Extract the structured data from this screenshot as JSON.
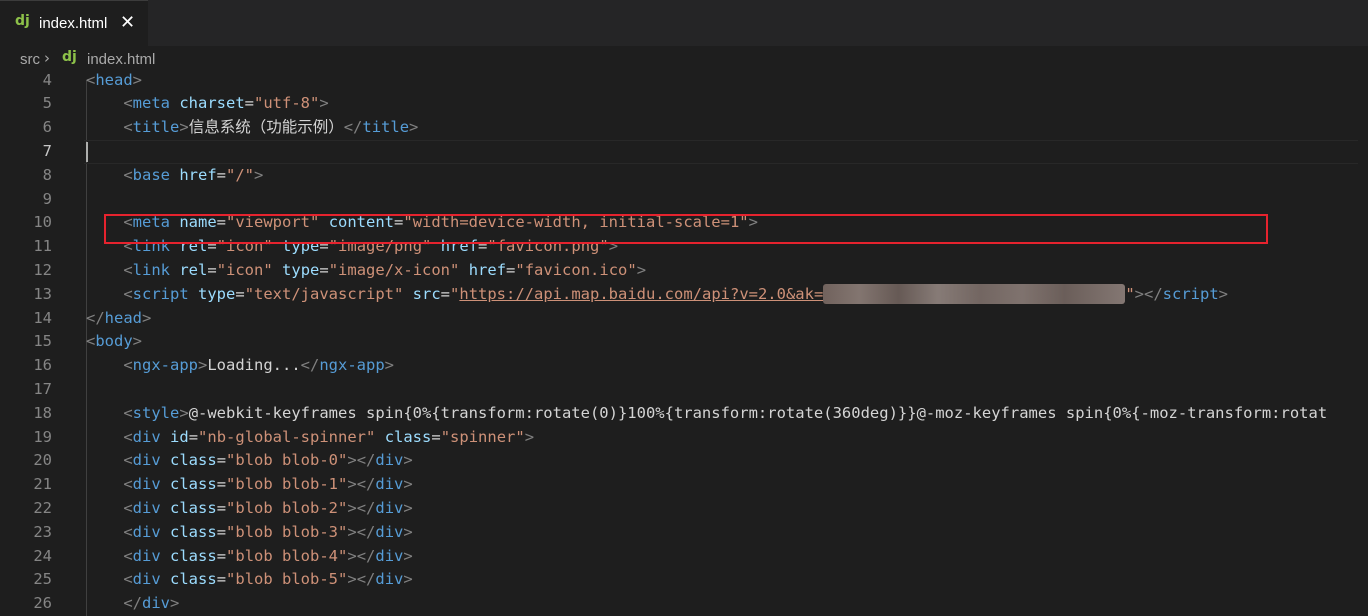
{
  "tab": {
    "icon": "dj",
    "label": "index.html",
    "close": "✕"
  },
  "breadcrumb": {
    "folder": "src",
    "separator": "›",
    "file_icon": "dj",
    "file": "index.html"
  },
  "editor": {
    "active_line": "7",
    "lines": [
      {
        "n": "4",
        "tokens": [
          [
            "punc",
            "<"
          ],
          [
            "tag",
            "head"
          ],
          [
            "punc",
            ">"
          ]
        ]
      },
      {
        "n": "5",
        "tokens": [
          [
            "txt",
            "    "
          ],
          [
            "punc",
            "<"
          ],
          [
            "tag",
            "meta"
          ],
          [
            "txt",
            " "
          ],
          [
            "attr",
            "charset"
          ],
          [
            "txt",
            "="
          ],
          [
            "str",
            "\"utf-8\""
          ],
          [
            "punc",
            ">"
          ]
        ]
      },
      {
        "n": "6",
        "tokens": [
          [
            "txt",
            "    "
          ],
          [
            "punc",
            "<"
          ],
          [
            "tag",
            "title"
          ],
          [
            "punc",
            ">"
          ],
          [
            "txt",
            "信息系统（功能示例）"
          ],
          [
            "punc",
            "</"
          ],
          [
            "tag",
            "title"
          ],
          [
            "punc",
            ">"
          ]
        ]
      },
      {
        "n": "7",
        "tokens": []
      },
      {
        "n": "8",
        "tokens": [
          [
            "txt",
            "    "
          ],
          [
            "punc",
            "<"
          ],
          [
            "tag",
            "base"
          ],
          [
            "txt",
            " "
          ],
          [
            "attr",
            "href"
          ],
          [
            "txt",
            "="
          ],
          [
            "str",
            "\"/\""
          ],
          [
            "punc",
            ">"
          ]
        ]
      },
      {
        "n": "9",
        "tokens": []
      },
      {
        "n": "10",
        "tokens": [
          [
            "txt",
            "    "
          ],
          [
            "punc",
            "<"
          ],
          [
            "tag",
            "meta"
          ],
          [
            "txt",
            " "
          ],
          [
            "attr",
            "name"
          ],
          [
            "txt",
            "="
          ],
          [
            "str",
            "\"viewport\""
          ],
          [
            "txt",
            " "
          ],
          [
            "attr",
            "content"
          ],
          [
            "txt",
            "="
          ],
          [
            "str",
            "\"width=device-width, initial-scale=1\""
          ],
          [
            "punc",
            ">"
          ]
        ]
      },
      {
        "n": "11",
        "tokens": [
          [
            "txt",
            "    "
          ],
          [
            "punc",
            "<"
          ],
          [
            "tag",
            "link"
          ],
          [
            "txt",
            " "
          ],
          [
            "attr",
            "rel"
          ],
          [
            "txt",
            "="
          ],
          [
            "str",
            "\"icon\""
          ],
          [
            "txt",
            " "
          ],
          [
            "attr",
            "type"
          ],
          [
            "txt",
            "="
          ],
          [
            "str",
            "\"image/png\""
          ],
          [
            "txt",
            " "
          ],
          [
            "attr",
            "href"
          ],
          [
            "txt",
            "="
          ],
          [
            "str",
            "\"favicon.png\""
          ],
          [
            "punc",
            ">"
          ]
        ]
      },
      {
        "n": "12",
        "tokens": [
          [
            "txt",
            "    "
          ],
          [
            "punc",
            "<"
          ],
          [
            "tag",
            "link"
          ],
          [
            "txt",
            " "
          ],
          [
            "attr",
            "rel"
          ],
          [
            "txt",
            "="
          ],
          [
            "str",
            "\"icon\""
          ],
          [
            "txt",
            " "
          ],
          [
            "attr",
            "type"
          ],
          [
            "txt",
            "="
          ],
          [
            "str",
            "\"image/x-icon\""
          ],
          [
            "txt",
            " "
          ],
          [
            "attr",
            "href"
          ],
          [
            "txt",
            "="
          ],
          [
            "str",
            "\"favicon.ico\""
          ],
          [
            "punc",
            ">"
          ]
        ]
      },
      {
        "n": "13",
        "tokens": [
          [
            "txt",
            "    "
          ],
          [
            "punc",
            "<"
          ],
          [
            "tag",
            "script"
          ],
          [
            "txt",
            " "
          ],
          [
            "attr",
            "type"
          ],
          [
            "txt",
            "="
          ],
          [
            "str",
            "\"text/javascript\""
          ],
          [
            "txt",
            " "
          ],
          [
            "attr",
            "src"
          ],
          [
            "txt",
            "="
          ],
          [
            "str",
            "\""
          ],
          [
            "link",
            "https://api.map.baidu.com/api?v=2.0&ak="
          ],
          [
            "blur",
            ""
          ],
          [
            "str",
            "\""
          ],
          [
            "punc",
            "></"
          ],
          [
            "tag",
            "script"
          ],
          [
            "punc",
            ">"
          ]
        ]
      },
      {
        "n": "14",
        "tokens": [
          [
            "punc",
            "</"
          ],
          [
            "tag",
            "head"
          ],
          [
            "punc",
            ">"
          ]
        ]
      },
      {
        "n": "15",
        "tokens": [
          [
            "punc",
            "<"
          ],
          [
            "tag",
            "body"
          ],
          [
            "punc",
            ">"
          ]
        ]
      },
      {
        "n": "16",
        "tokens": [
          [
            "txt",
            "    "
          ],
          [
            "punc",
            "<"
          ],
          [
            "tag",
            "ngx-app"
          ],
          [
            "punc",
            ">"
          ],
          [
            "txt",
            "Loading..."
          ],
          [
            "punc",
            "</"
          ],
          [
            "tag",
            "ngx-app"
          ],
          [
            "punc",
            ">"
          ]
        ]
      },
      {
        "n": "17",
        "tokens": []
      },
      {
        "n": "18",
        "tokens": [
          [
            "txt",
            "    "
          ],
          [
            "punc",
            "<"
          ],
          [
            "tag",
            "style"
          ],
          [
            "punc",
            ">"
          ],
          [
            "txt",
            "@-webkit-keyframes spin{0%{transform:rotate(0)}100%{transform:rotate(360deg)}}@-moz-keyframes spin{0%{-moz-transform:rotat"
          ]
        ]
      },
      {
        "n": "19",
        "tokens": [
          [
            "txt",
            "    "
          ],
          [
            "punc",
            "<"
          ],
          [
            "tag",
            "div"
          ],
          [
            "txt",
            " "
          ],
          [
            "attr",
            "id"
          ],
          [
            "txt",
            "="
          ],
          [
            "str",
            "\"nb-global-spinner\""
          ],
          [
            "txt",
            " "
          ],
          [
            "attr",
            "class"
          ],
          [
            "txt",
            "="
          ],
          [
            "str",
            "\"spinner\""
          ],
          [
            "punc",
            ">"
          ]
        ]
      },
      {
        "n": "20",
        "tokens": [
          [
            "txt",
            "    "
          ],
          [
            "punc",
            "<"
          ],
          [
            "tag",
            "div"
          ],
          [
            "txt",
            " "
          ],
          [
            "attr",
            "class"
          ],
          [
            "txt",
            "="
          ],
          [
            "str",
            "\"blob blob-0\""
          ],
          [
            "punc",
            "></"
          ],
          [
            "tag",
            "div"
          ],
          [
            "punc",
            ">"
          ]
        ]
      },
      {
        "n": "21",
        "tokens": [
          [
            "txt",
            "    "
          ],
          [
            "punc",
            "<"
          ],
          [
            "tag",
            "div"
          ],
          [
            "txt",
            " "
          ],
          [
            "attr",
            "class"
          ],
          [
            "txt",
            "="
          ],
          [
            "str",
            "\"blob blob-1\""
          ],
          [
            "punc",
            "></"
          ],
          [
            "tag",
            "div"
          ],
          [
            "punc",
            ">"
          ]
        ]
      },
      {
        "n": "22",
        "tokens": [
          [
            "txt",
            "    "
          ],
          [
            "punc",
            "<"
          ],
          [
            "tag",
            "div"
          ],
          [
            "txt",
            " "
          ],
          [
            "attr",
            "class"
          ],
          [
            "txt",
            "="
          ],
          [
            "str",
            "\"blob blob-2\""
          ],
          [
            "punc",
            "></"
          ],
          [
            "tag",
            "div"
          ],
          [
            "punc",
            ">"
          ]
        ]
      },
      {
        "n": "23",
        "tokens": [
          [
            "txt",
            "    "
          ],
          [
            "punc",
            "<"
          ],
          [
            "tag",
            "div"
          ],
          [
            "txt",
            " "
          ],
          [
            "attr",
            "class"
          ],
          [
            "txt",
            "="
          ],
          [
            "str",
            "\"blob blob-3\""
          ],
          [
            "punc",
            "></"
          ],
          [
            "tag",
            "div"
          ],
          [
            "punc",
            ">"
          ]
        ]
      },
      {
        "n": "24",
        "tokens": [
          [
            "txt",
            "    "
          ],
          [
            "punc",
            "<"
          ],
          [
            "tag",
            "div"
          ],
          [
            "txt",
            " "
          ],
          [
            "attr",
            "class"
          ],
          [
            "txt",
            "="
          ],
          [
            "str",
            "\"blob blob-4\""
          ],
          [
            "punc",
            "></"
          ],
          [
            "tag",
            "div"
          ],
          [
            "punc",
            ">"
          ]
        ]
      },
      {
        "n": "25",
        "tokens": [
          [
            "txt",
            "    "
          ],
          [
            "punc",
            "<"
          ],
          [
            "tag",
            "div"
          ],
          [
            "txt",
            " "
          ],
          [
            "attr",
            "class"
          ],
          [
            "txt",
            "="
          ],
          [
            "str",
            "\"blob blob-5\""
          ],
          [
            "punc",
            "></"
          ],
          [
            "tag",
            "div"
          ],
          [
            "punc",
            ">"
          ]
        ]
      },
      {
        "n": "26",
        "tokens": [
          [
            "txt",
            "    "
          ],
          [
            "punc",
            "</"
          ],
          [
            "tag",
            "div"
          ],
          [
            "punc",
            ">"
          ]
        ]
      }
    ]
  },
  "highlight": {
    "color": "#e6232e",
    "line": "13"
  },
  "colors": {
    "background": "#1e1e1e",
    "tag": "#569cd6",
    "attribute": "#9cdcfe",
    "string": "#ce9178",
    "punctuation": "#808080",
    "line_number": "#858585",
    "django_icon": "#8dc149"
  }
}
